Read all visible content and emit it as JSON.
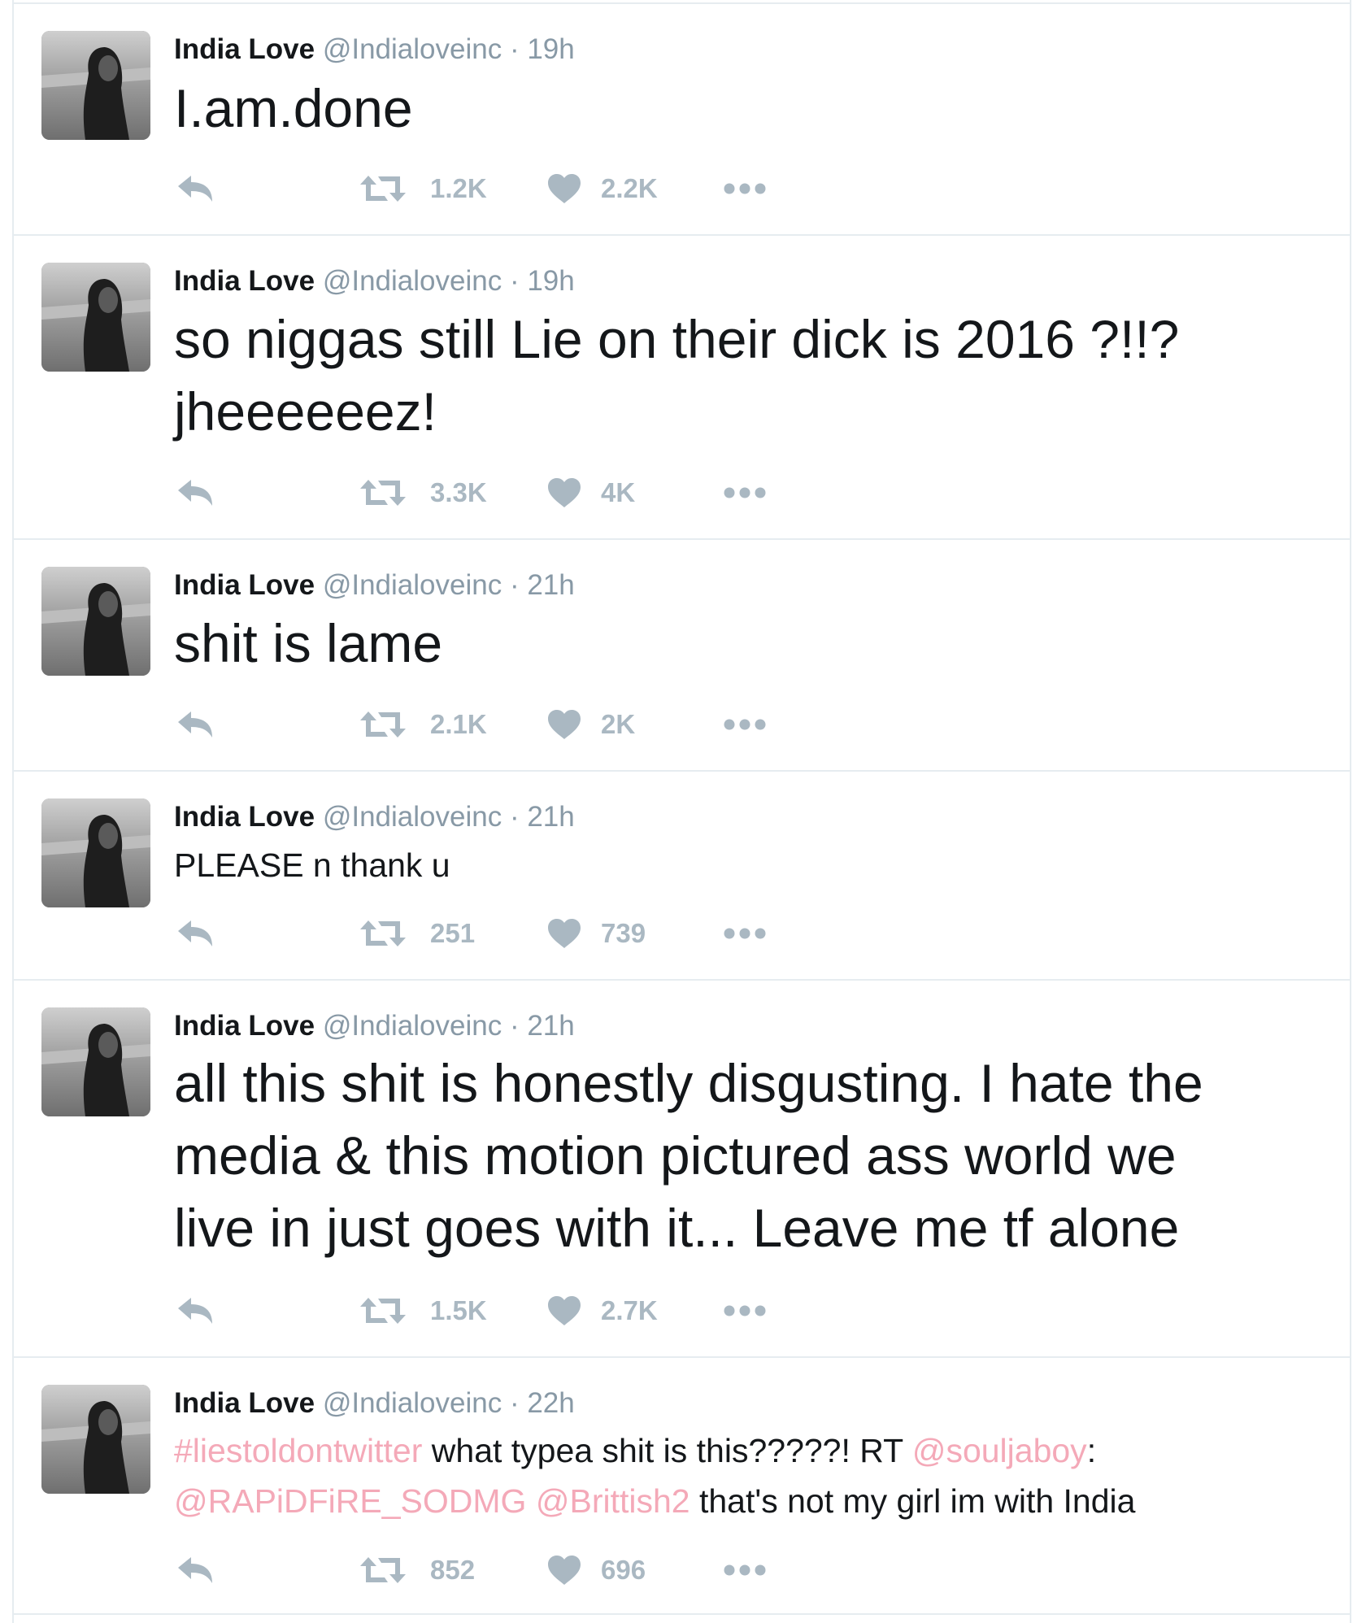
{
  "colors": {
    "name": "#14171a",
    "meta": "#8899a6",
    "icon": "#aab8c2",
    "link": "#f4a9b8",
    "divider": "#e6ecf0"
  },
  "tweets": [
    {
      "name": "India Love",
      "handle": "@Indialoveinc",
      "sep": "·",
      "time": "19h",
      "text": "I.am.done",
      "retweets": "1.2K",
      "likes": "2.2K"
    },
    {
      "name": "India Love",
      "handle": "@Indialoveinc",
      "sep": "·",
      "time": "19h",
      "line1": "so niggas still Lie on their dick is 2016 ?!!?",
      "line2": "jheeeeeez!",
      "retweets": "3.3K",
      "likes": "4K"
    },
    {
      "name": "India Love",
      "handle": "@Indialoveinc",
      "sep": "·",
      "time": "21h",
      "text": "shit is lame",
      "retweets": "2.1K",
      "likes": "2K"
    },
    {
      "name": "India Love",
      "handle": "@Indialoveinc",
      "sep": "·",
      "time": "21h",
      "text": "PLEASE n thank u",
      "retweets": "251",
      "likes": "739"
    },
    {
      "name": "India Love",
      "handle": "@Indialoveinc",
      "sep": "·",
      "time": "21h",
      "line1": "all this shit is honestly disgusting. I hate the",
      "line2": "media & this motion pictured ass world we",
      "line3": "live in just goes with it... Leave me tf alone",
      "retweets": "1.5K",
      "likes": "2.7K"
    },
    {
      "name": "India Love",
      "handle": "@Indialoveinc",
      "sep": "·",
      "time": "22h",
      "hashtag": "#liestoldontwitter",
      "text_a": " what typea shit is this?????! RT ",
      "mention1": "@souljaboy",
      "colon": ":",
      "mention2": "@RAPiDFiRE_SODMG",
      "space": " ",
      "mention3": "@Brittish2",
      "text_b": " that's not my girl im with India",
      "retweets": "852",
      "likes": "696"
    }
  ]
}
